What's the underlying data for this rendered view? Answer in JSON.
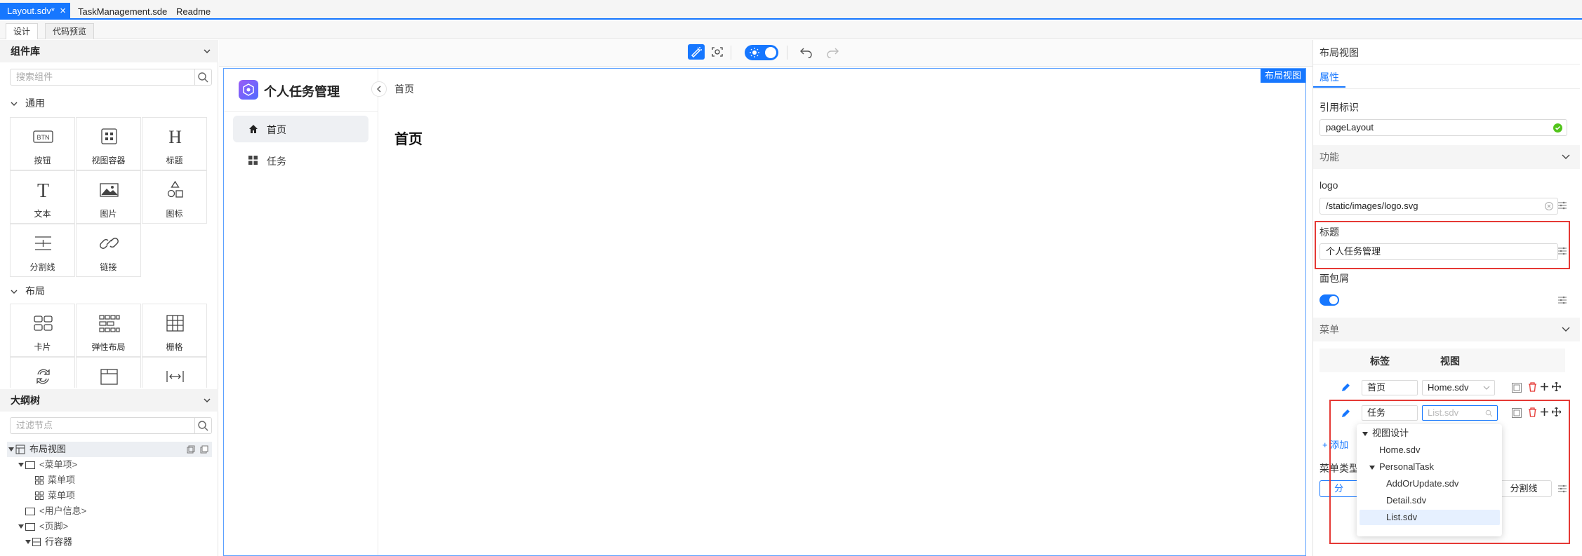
{
  "file_tabs": [
    "Layout.sdv*",
    "TaskManagement.sde",
    "Readme"
  ],
  "sub_tabs": [
    "设计",
    "代码预览"
  ],
  "component_library": {
    "title": "组件库",
    "search_placeholder": "搜索组件",
    "groups": [
      {
        "name": "通用",
        "items": [
          "按钮",
          "视图容器",
          "标题",
          "文本",
          "图片",
          "图标",
          "分割线",
          "链接"
        ]
      },
      {
        "name": "布局",
        "items": [
          "卡片",
          "弹性布局",
          "栅格",
          "",
          "",
          ""
        ]
      }
    ],
    "icon_texts": {
      "button": "BTN",
      "heading": "H",
      "text": "T"
    }
  },
  "outline": {
    "title": "大纲树",
    "search_placeholder": "过滤节点",
    "nodes": [
      "布局视图",
      "<菜单项>",
      "菜单项",
      "菜单项",
      "<用户信息>",
      "<页脚>",
      "行容器"
    ]
  },
  "canvas": {
    "badge": "布局视图",
    "app_title": "个人任务管理",
    "breadcrumb": "首页",
    "menu": [
      "首页",
      "任务"
    ],
    "page_heading": "首页"
  },
  "properties": {
    "header": "布局视图",
    "tab": "属性",
    "ref_label": "引用标识",
    "ref_value": "pageLayout",
    "section_function": "功能",
    "logo_label": "logo",
    "logo_value": "/static/images/logo.svg",
    "title_label": "标题",
    "title_value": "个人任务管理",
    "breadcrumb_label": "面包屑",
    "breadcrumb_enabled": true,
    "section_menu": "菜单",
    "menu_col_label": "标签",
    "menu_col_view": "视图",
    "menu_rows": [
      {
        "label": "首页",
        "view": "Home.sdv"
      },
      {
        "label": "任务",
        "view": "List.sdv"
      }
    ],
    "add_text": "添加",
    "menu_type_label": "菜单类型",
    "menu_type_opt1": "分",
    "menu_type_opt2": "分割线"
  },
  "dropdown": {
    "root": "视图设计",
    "home": "Home.sdv",
    "folder": "PersonalTask",
    "files": [
      "AddOrUpdate.sdv",
      "Detail.sdv",
      "List.sdv"
    ]
  },
  "colors": {
    "accent": "#1677ff",
    "highlight": "#e53935",
    "ok": "#52c41a"
  }
}
